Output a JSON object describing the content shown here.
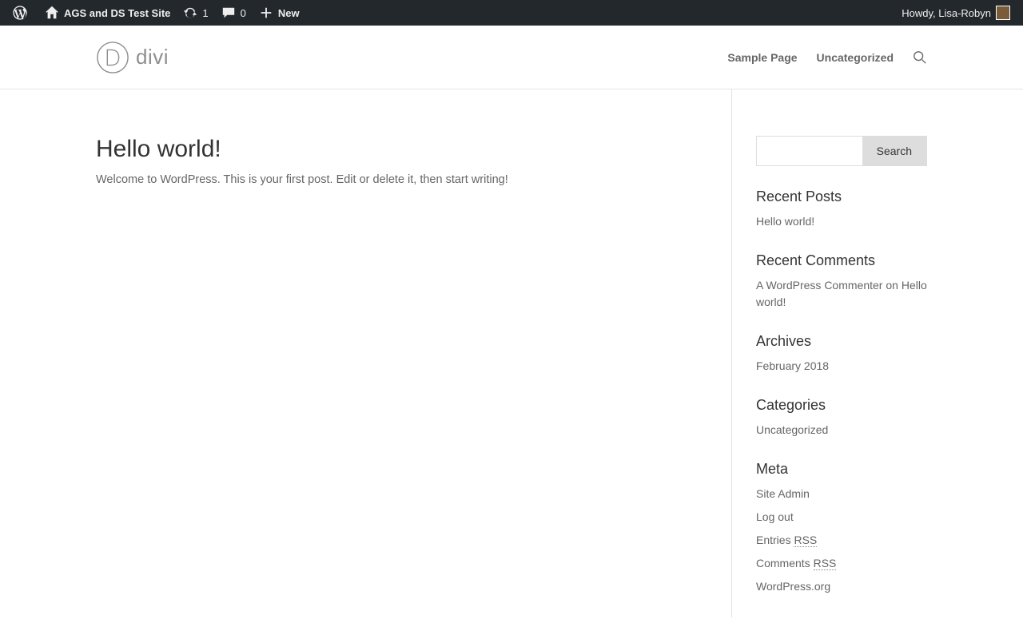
{
  "adminBar": {
    "siteName": "AGS and DS Test Site",
    "updateCount": "1",
    "commentCount": "0",
    "newLabel": "New",
    "greeting": "Howdy, Lisa-Robyn"
  },
  "header": {
    "logoText": "divi",
    "nav": {
      "samplePage": "Sample Page",
      "uncategorized": "Uncategorized"
    }
  },
  "post": {
    "title": "Hello world!",
    "content": "Welcome to WordPress. This is your first post. Edit or delete it, then start writing!"
  },
  "sidebar": {
    "searchButton": "Search",
    "recentPosts": {
      "heading": "Recent Posts",
      "item1": "Hello world!"
    },
    "recentComments": {
      "heading": "Recent Comments",
      "commenter": "A WordPress Commenter",
      "on": " on ",
      "postTitle": "Hello world!"
    },
    "archives": {
      "heading": "Archives",
      "item1": "February 2018"
    },
    "categories": {
      "heading": "Categories",
      "item1": "Uncategorized"
    },
    "meta": {
      "heading": "Meta",
      "siteAdmin": "Site Admin",
      "logOut": "Log out",
      "entries": "Entries ",
      "entriesRss": "RSS",
      "comments": "Comments ",
      "commentsRss": "RSS",
      "wpOrg": "WordPress.org"
    }
  }
}
